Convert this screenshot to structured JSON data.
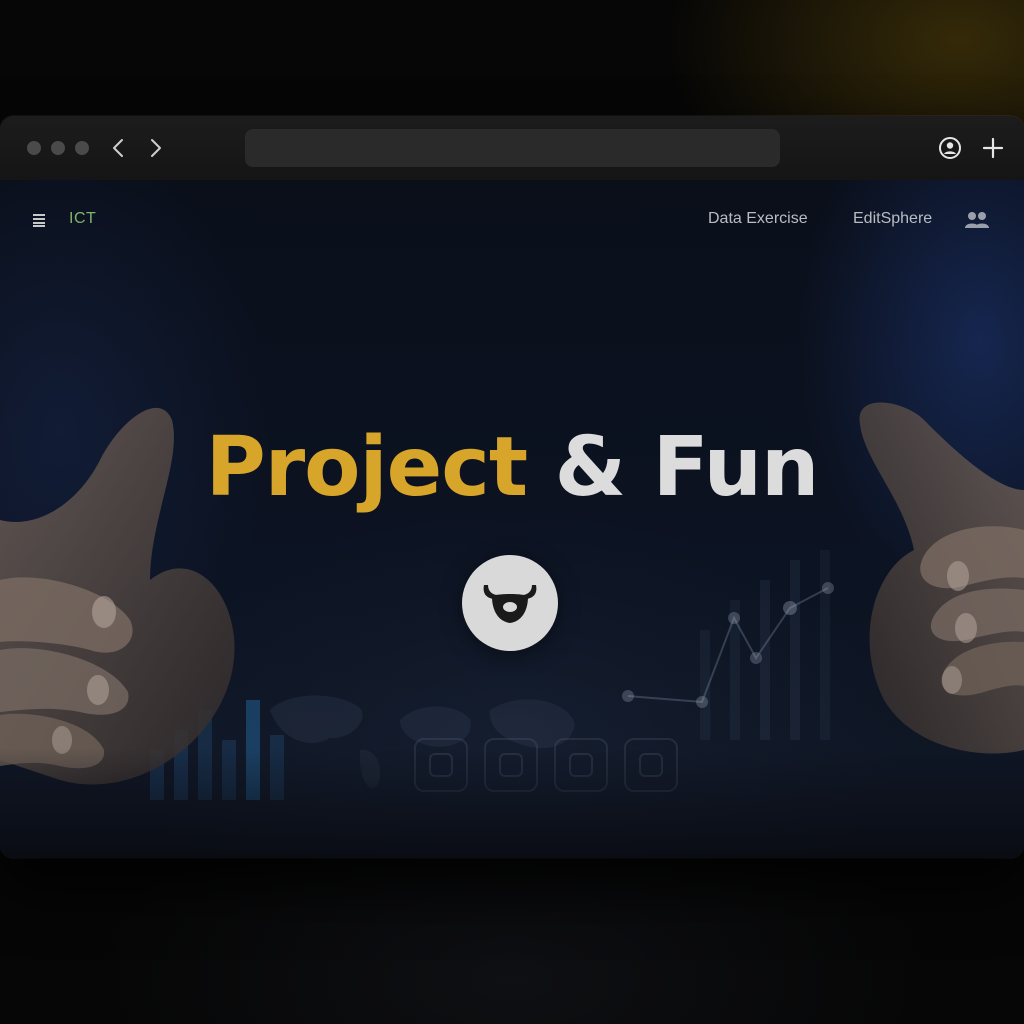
{
  "browser": {
    "url": "",
    "icons": {
      "back": "chevron-left-icon",
      "forward": "chevron-right-icon",
      "profile": "user-circle-icon",
      "new_tab": "plus-icon"
    }
  },
  "nav": {
    "brand": "ICT",
    "links": [
      "Data Exercise",
      "EditSphere"
    ],
    "menu_icon": "menu-icon",
    "users_icon": "users-icon"
  },
  "hero": {
    "title_part1": "Project",
    "title_part2": "& Fun",
    "logo_icon": "bull-head-icon"
  },
  "colors": {
    "accent_gold": "#d7a52a",
    "title_light": "#dcdcdc",
    "brand_green": "#7fb56a",
    "nav_text": "#b9bcc4"
  }
}
